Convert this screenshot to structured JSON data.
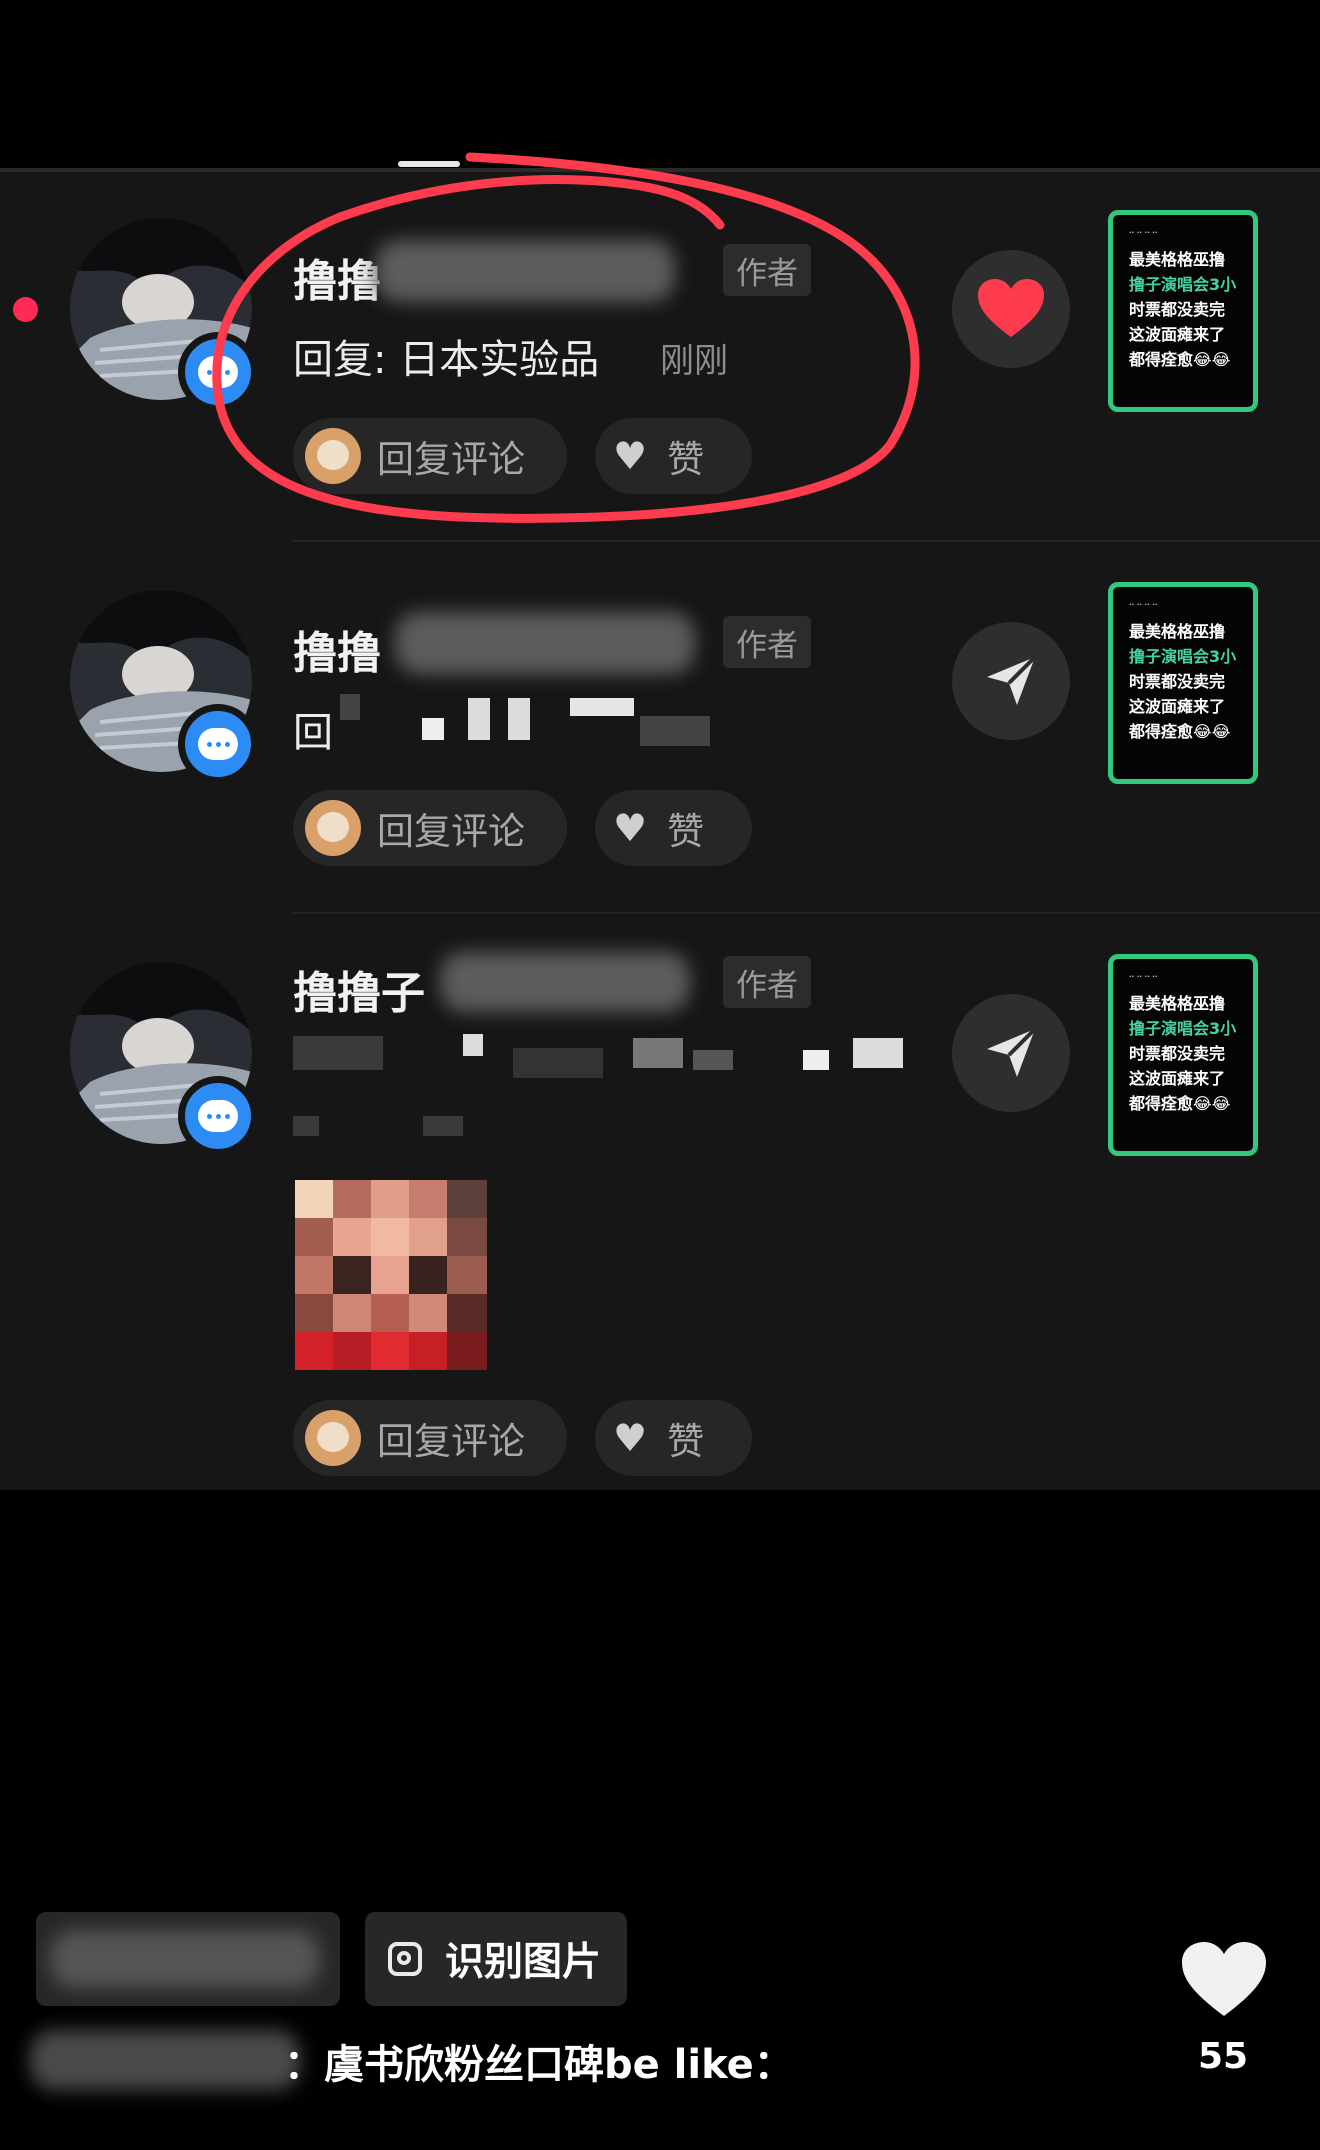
{
  "comments": [
    {
      "name_visible": "撸撸",
      "author_badge": "作者",
      "reply_text": "回复: 日本实验品",
      "time": "刚刚",
      "reply_button": "回复评论",
      "like_button": "赞"
    },
    {
      "name_visible": "撸撸",
      "author_badge": "作者",
      "reply_prefix": "回",
      "reply_button": "回复评论",
      "like_button": "赞"
    },
    {
      "name_visible": "撸撸子",
      "author_badge": "作者",
      "reply_button": "回复评论",
      "like_button": "赞"
    }
  ],
  "video_thumb": {
    "lines": [
      "最美格格巫撸",
      "撸子演唱会3小",
      "时票都没卖完",
      "这波面瘫来了",
      "都得痊愈😂😂"
    ]
  },
  "bottom": {
    "recognize_label": "识别图片",
    "caption": "：虞书欣粉丝口碑be like：",
    "like_count": "55"
  },
  "colors": {
    "accent_red": "#ff3b4e",
    "badge_blue": "#2c8cf4",
    "thumb_green": "#34c77e"
  },
  "icons": [
    "chat-badge-icon",
    "heart-icon",
    "send-icon",
    "scan-icon"
  ]
}
